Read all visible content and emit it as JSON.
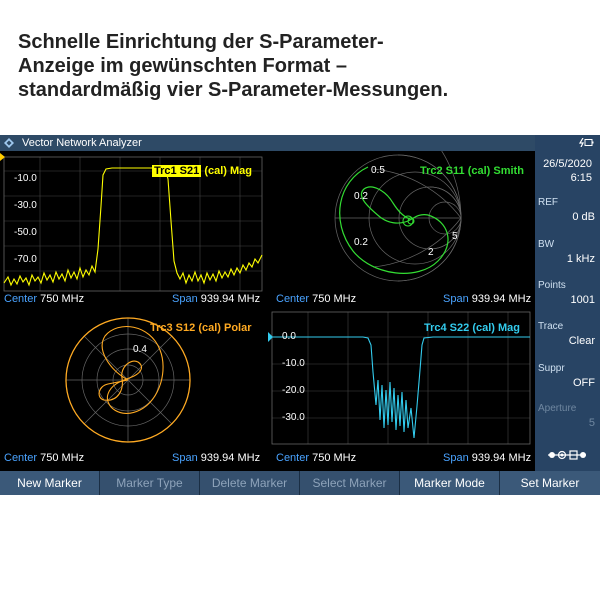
{
  "headline": {
    "line1": "Schnelle Einrichtung der S-Parameter-",
    "line2": "Anzeige im gewünschten Format –",
    "line3": "standardmäßig vier S-Parameter-Messungen."
  },
  "app": {
    "title": "Vector Network Analyzer",
    "logo_icon": "rohde-schwarz-logo-icon",
    "battery_icon": "battery-icon"
  },
  "colors": {
    "trc1": "#ffff00",
    "trc2": "#33dd33",
    "trc3": "#ffaa22",
    "trc4": "#33ccee",
    "info_blue": "#4aa3ff",
    "titlebar": "#2e4a66",
    "sidebar": "#284464"
  },
  "panels": {
    "trc1": {
      "label_box": "Trc1 S21",
      "label_rest": " (cal) Mag",
      "ticks": [
        "-10.0",
        "-30.0",
        "-50.0",
        "-70.0"
      ],
      "center_label": "Center",
      "center_value": "750 MHz",
      "span_label": "Span",
      "span_value": "939.94 MHz"
    },
    "trc2": {
      "label": "Trc2 S11 (cal) Smith",
      "ticks": [
        "0.5",
        "0.2",
        "0.2",
        "2",
        "5"
      ],
      "center_label": "Center",
      "center_value": "750 MHz",
      "span_label": "Span",
      "span_value": "939.94 MHz"
    },
    "trc3": {
      "label": "Trc3 S12 (cal) Polar",
      "ticks": [
        "0.4"
      ],
      "center_label": "Center",
      "center_value": "750 MHz",
      "span_label": "Span",
      "span_value": "939.94 MHz"
    },
    "trc4": {
      "label": "Trc4 S22 (cal) Mag",
      "ticks": [
        "0.0",
        "-10.0",
        "-20.0",
        "-30.0"
      ],
      "center_label": "Center",
      "center_value": "750 MHz",
      "span_label": "Span",
      "span_value": "939.94 MHz"
    }
  },
  "sidebar": {
    "date": "26/5/2020",
    "time": "6:15",
    "items": [
      {
        "label": "REF",
        "value": "0 dB"
      },
      {
        "label": "BW",
        "value": "1 kHz"
      },
      {
        "label": "Points",
        "value": "1001"
      },
      {
        "label": "Trace",
        "value": "Clear"
      },
      {
        "label": "Suppr",
        "value": "OFF"
      },
      {
        "label": "Aperture",
        "value": "5"
      }
    ],
    "sparam_icon": "s-parameter-ports-icon"
  },
  "softkeys": [
    "New Marker",
    "Marker Type",
    "Delete Marker",
    "Select Marker",
    "Marker Mode",
    "Set Marker"
  ]
}
